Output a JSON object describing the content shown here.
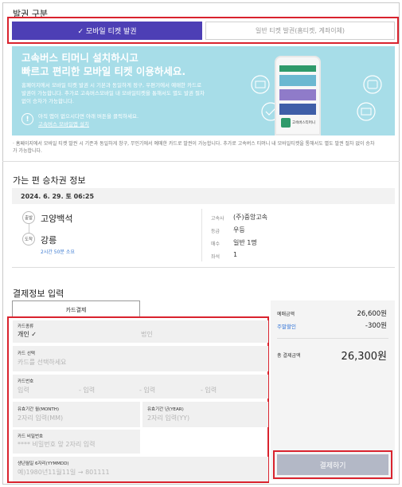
{
  "issue_section": {
    "title": "발권 구분",
    "mobile_tab": "✓ 모바일 티켓 발권",
    "paper_tab": "일반 티켓 발권(홈티켓, 계좌이체)"
  },
  "banner": {
    "heading_line1": "고속버스 티머니 설치하시고",
    "heading_line2": "빠르고 편리한 모바일 티켓 이용하세요.",
    "desc_line1": "홈페이지에서 모바일 티켓 발권 시 기본과 동일하게 정구, 우편기에서 예매한 카드로",
    "desc_line2": "발권이 가능합니다. 추가로 고속버스모바일 내 모바일티켓을 통해서도 별도 발권 절차",
    "desc_line3": "없이 승차가 가능합니다.",
    "notice_line1": "아직 앱이 없으시다면 아래 버튼을 클릭하세요.",
    "install_link": "고속버스 모바일앱 설치",
    "app_name": "고속버스티머니"
  },
  "footnote": {
    "line1": "· 홈페이지에서 모바일 티켓 발권 시 기존과 동일하게 창구, 무인기에서 예매한 카드로 발권이 가능합니다. 추가로 고속버스 티머니 내 모바일티켓을 통해서도 별도 발권 절차 없이 승차",
    "line2": "  가 가능합니다."
  },
  "trip": {
    "section_title": "가는 편 승차권 정보",
    "date": "2024. 6. 29. 토 06:25",
    "dep_tag": "출발",
    "arr_tag": "도착",
    "departure": "고양백석",
    "arrival": "강릉",
    "duration": "2시간 50분 소요",
    "details": [
      {
        "label": "고속사",
        "value": "(주)중앙고속"
      },
      {
        "label": "등급",
        "value": "우등"
      },
      {
        "label": "매수",
        "value": "일반 1명"
      },
      {
        "label": "좌석",
        "value": "1"
      }
    ]
  },
  "payment": {
    "section_title": "결제정보 입력",
    "card_tab": "카드결제",
    "card_type_label": "카드종류",
    "card_type_personal": "개인 ✓",
    "card_type_corporate": "법인",
    "card_select_label": "카드 선택",
    "card_select_placeholder": "카드를 선택하세요",
    "card_number_label": "카드번호",
    "card_number_ph1": "입력",
    "card_number_ph2": "- 입력",
    "card_number_ph3": "- 입력",
    "card_number_ph4": "- 입력",
    "expiry_month_label": "유효기간 월(MONTH)",
    "expiry_month_ph": "2자리 입력(MM)",
    "expiry_year_label": "유효기간 년(YEAR)",
    "expiry_year_ph": "2자리 입력(YY)",
    "password_label": "카드 비밀번호",
    "password_ph": "**** 비밀번호 앞 2자리 입력",
    "birth_label": "생년월일 6자리(YYMMDD)",
    "birth_ph": "예)1980년11월11일 → 801111"
  },
  "summary": {
    "fare_label": "예매금액",
    "fare_value": "26,600원",
    "discount_label": "주말할인",
    "discount_value": "-300원",
    "total_label": "총 결제금액",
    "total_value": "26,300원",
    "pay_button": "결제하기"
  },
  "colors": {
    "accent": "#4d3fb5",
    "highlight_border": "#d9232e",
    "banner_bg": "#a7dde8",
    "discount_link": "#2b6fd6",
    "pay_button_bg": "#b3b8c6"
  }
}
